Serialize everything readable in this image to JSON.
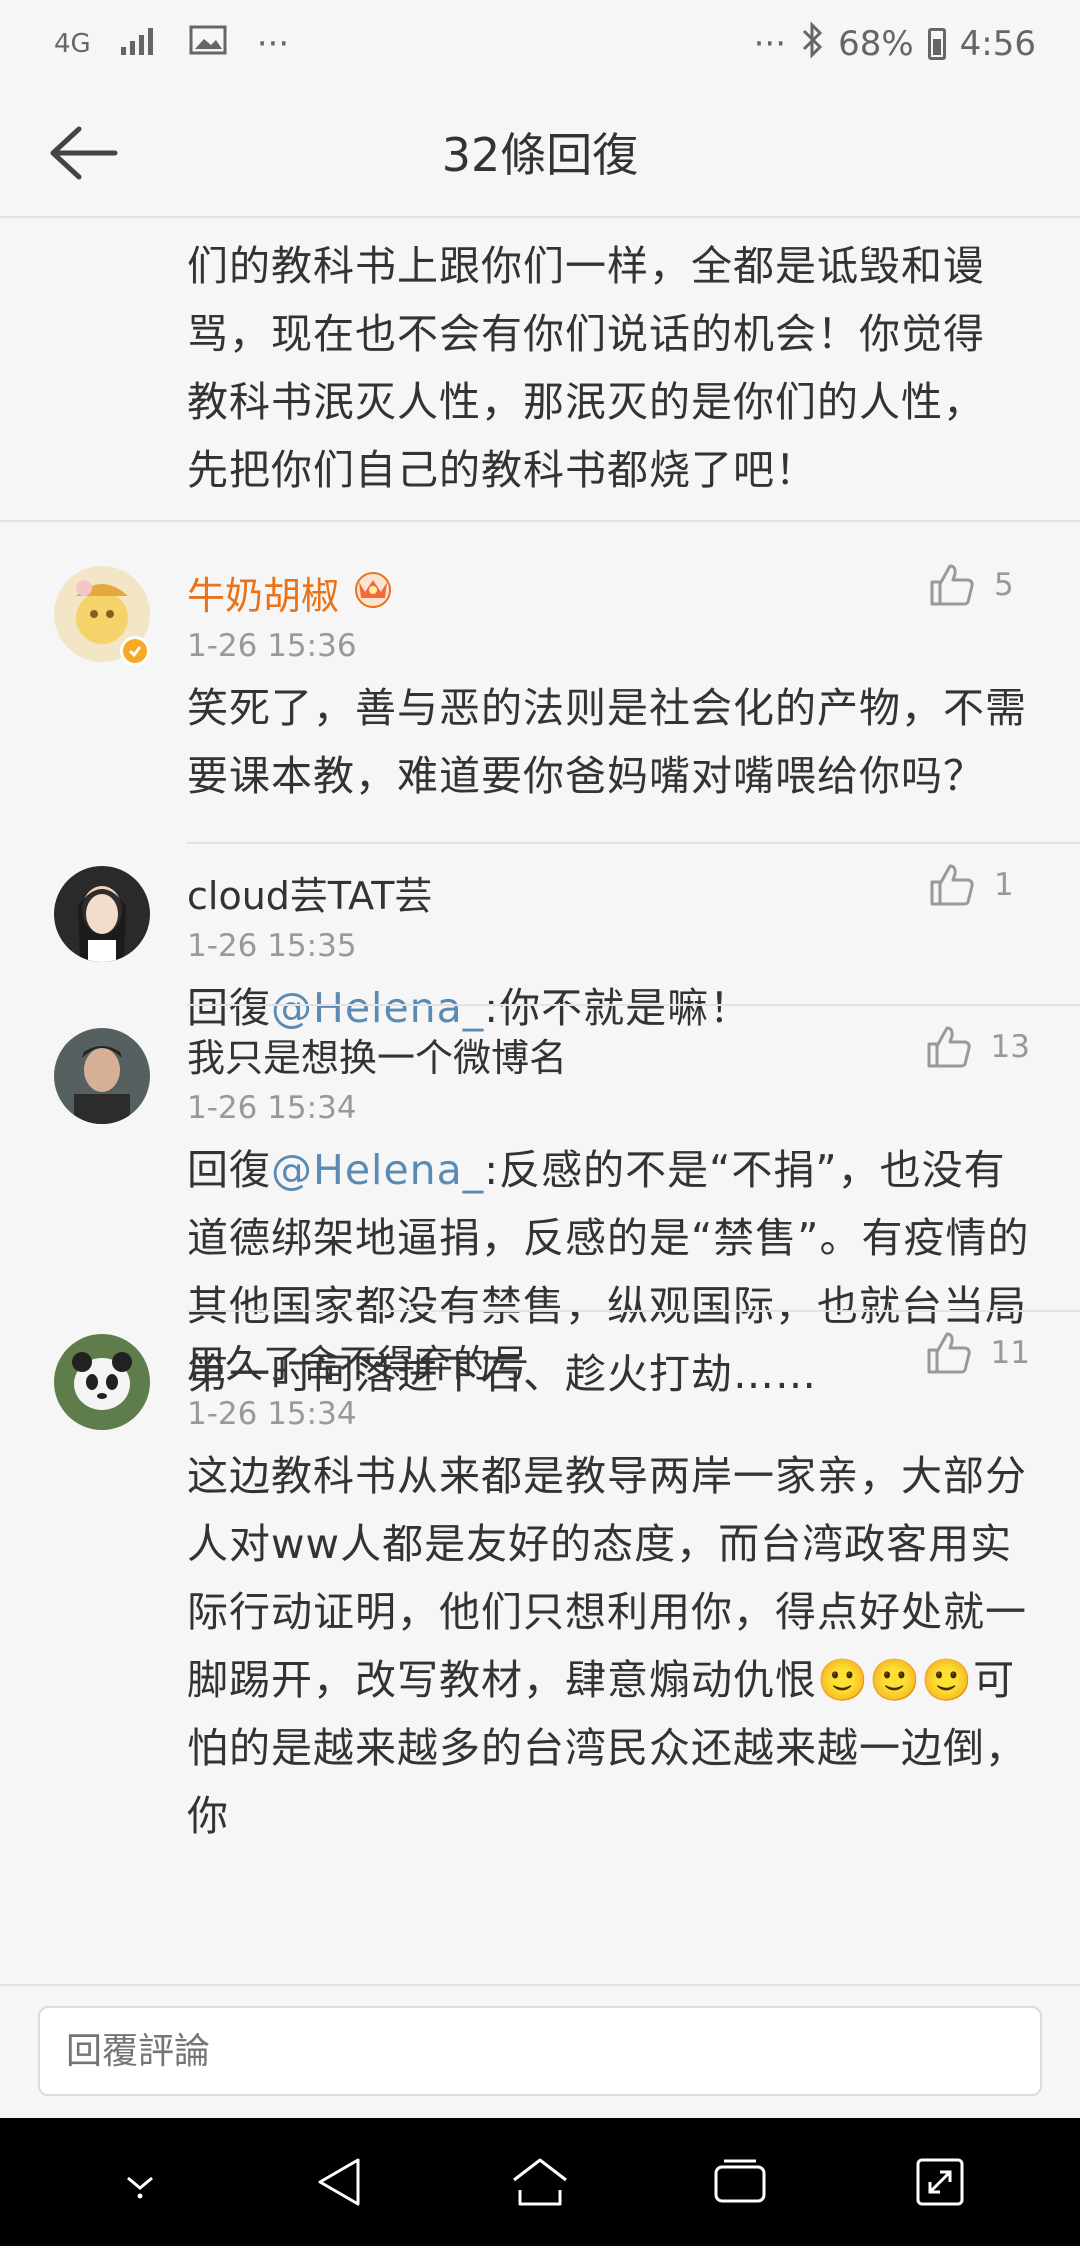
{
  "status_bar": {
    "network": "4G",
    "more": "···",
    "more_right": "···",
    "battery": "68%",
    "time": "4:56"
  },
  "header": {
    "title": "32條回復"
  },
  "partial_comment": {
    "text": "息”，两岸之间的仇恨会比现在N倍！如果我们的教科书上跟你们一样，全都是诋毁和谩骂，现在也不会有你们说话的机会！你觉得教科书泯灭人性，那泯灭的是你们的人性，先把你们自己的教科书都烧了吧！"
  },
  "comments": [
    {
      "username": "牛奶胡椒",
      "time": "1-26 15:36",
      "likes": "5",
      "text": "笑死了，善与恶的法则是社会化的产物，不需要课本教，难道要你爸妈嘴对嘴喂给你吗？"
    },
    {
      "username": "cloud芸TAT芸",
      "time": "1-26 15:35",
      "likes": "1",
      "reply_prefix": "回復",
      "mention": "@Helena_",
      "text": ":你不就是嘛！"
    },
    {
      "username": "我只是想换一个微博名",
      "time": "1-26 15:34",
      "likes": "13",
      "reply_prefix": "回復",
      "mention": "@Helena_",
      "text": ":反感的不是“不捐”，也没有道德绑架地逼捐，反感的是“禁售”。有疫情的其他国家都没有禁售，纵观国际，也就台当局第一时间落进下石、趁火打劫……"
    },
    {
      "username": "用久了舍不得弃的号",
      "time": "1-26 15:34",
      "likes": "11",
      "text": "这边教科书从来都是教导两岸一家亲，大部分人对ww人都是友好的态度，而台湾政客用实际行动证明，他们只想利用你，得点好处就一脚踢开，改写教材，肆意煽动仇恨",
      "emoji": "🙂🙂🙂",
      "text_after": "可怕的是越来越多的台湾民众还越来越一边倒，你"
    }
  ],
  "reply_bar": {
    "placeholder": "回覆評論"
  },
  "colors": {
    "vip_name": "#e8731b",
    "mention": "#5b8bb5",
    "background": "#f6f6f6"
  }
}
